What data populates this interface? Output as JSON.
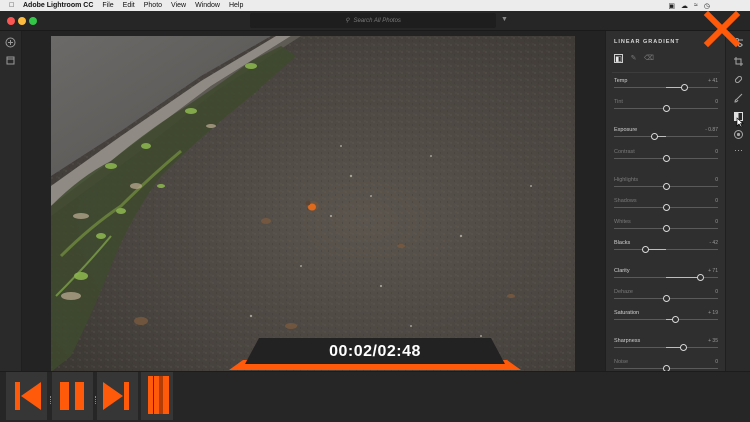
{
  "menubar": {
    "app_name": "Adobe Lightroom CC",
    "items": [
      "File",
      "Edit",
      "Photo",
      "View",
      "Window",
      "Help"
    ]
  },
  "search": {
    "placeholder": "Search All Photos"
  },
  "panel": {
    "title": "LINEAR GRADIENT",
    "sliders": [
      {
        "label": "Temp",
        "value": "+ 41",
        "level": 0.68,
        "dim": false
      },
      {
        "label": "Tint",
        "value": "0",
        "level": 0.5,
        "dim": true
      },
      {
        "label": "Exposure",
        "value": "- 0.87",
        "level": 0.39,
        "dim": false
      },
      {
        "label": "Contrast",
        "value": "0",
        "level": 0.5,
        "dim": true
      },
      {
        "label": "Highlights",
        "value": "0",
        "level": 0.5,
        "dim": true
      },
      {
        "label": "Shadows",
        "value": "0",
        "level": 0.5,
        "dim": true
      },
      {
        "label": "Whites",
        "value": "0",
        "level": 0.5,
        "dim": true
      },
      {
        "label": "Blacks",
        "value": "- 42",
        "level": 0.3,
        "dim": false
      },
      {
        "label": "Clarity",
        "value": "+ 71",
        "level": 0.83,
        "dim": false
      },
      {
        "label": "Dehaze",
        "value": "0",
        "level": 0.5,
        "dim": true
      },
      {
        "label": "Saturation",
        "value": "+ 19",
        "level": 0.59,
        "dim": false
      },
      {
        "label": "Sharpness",
        "value": "+ 35",
        "level": 0.67,
        "dim": false
      },
      {
        "label": "Noise",
        "value": "0",
        "level": 0.5,
        "dim": true
      }
    ]
  },
  "player": {
    "time": "00:02/02:48"
  },
  "colors": {
    "accent": "#ff5a0a",
    "panel": "#2f2f2f",
    "canvas": "#232323"
  },
  "icons": {
    "left_rail": [
      "add-photo-icon",
      "library-icon"
    ],
    "tool_rail": [
      "edit-sliders-icon",
      "crop-icon",
      "healing-brush-icon",
      "brush-icon",
      "linear-gradient-icon",
      "radial-gradient-icon",
      "more-icon"
    ],
    "transport": [
      "skip-back-icon",
      "pause-icon",
      "skip-forward-icon",
      "scrubber-icon"
    ]
  }
}
